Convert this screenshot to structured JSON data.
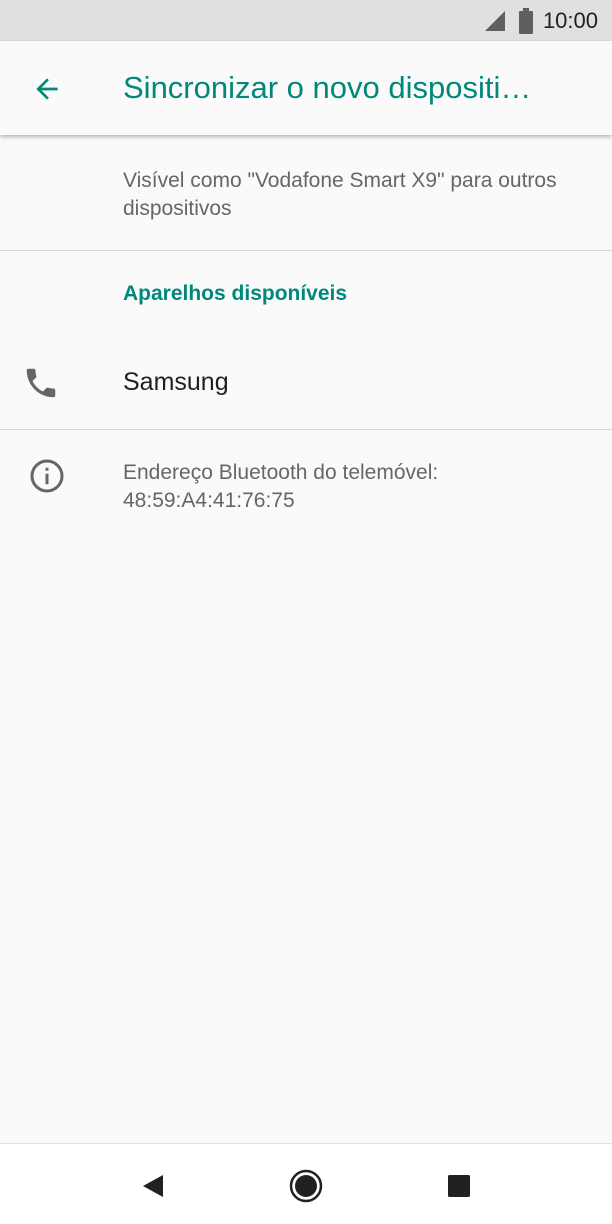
{
  "status_bar": {
    "time": "10:00",
    "icons": [
      "signal-icon",
      "battery-icon"
    ]
  },
  "app_bar": {
    "title": "Sincronizar o novo dispositi…",
    "back_icon": "arrow-back-icon"
  },
  "visibility": {
    "text": "Visível como \"Vodafone Smart X9\" para outros dispositivos"
  },
  "available_devices": {
    "header": "Aparelhos disponíveis",
    "items": [
      {
        "name": "Samsung",
        "icon": "phone-icon"
      }
    ]
  },
  "info": {
    "text": "Endereço Bluetooth do telemóvel: 48:59:A4:41:76:75",
    "icon": "info-icon"
  },
  "nav_bar": {
    "buttons": [
      "back-triangle-icon",
      "home-circle-icon",
      "recents-square-icon"
    ]
  },
  "colors": {
    "accent": "#00897b",
    "status_bar": "#e0e0e0",
    "background": "#fafafa"
  }
}
